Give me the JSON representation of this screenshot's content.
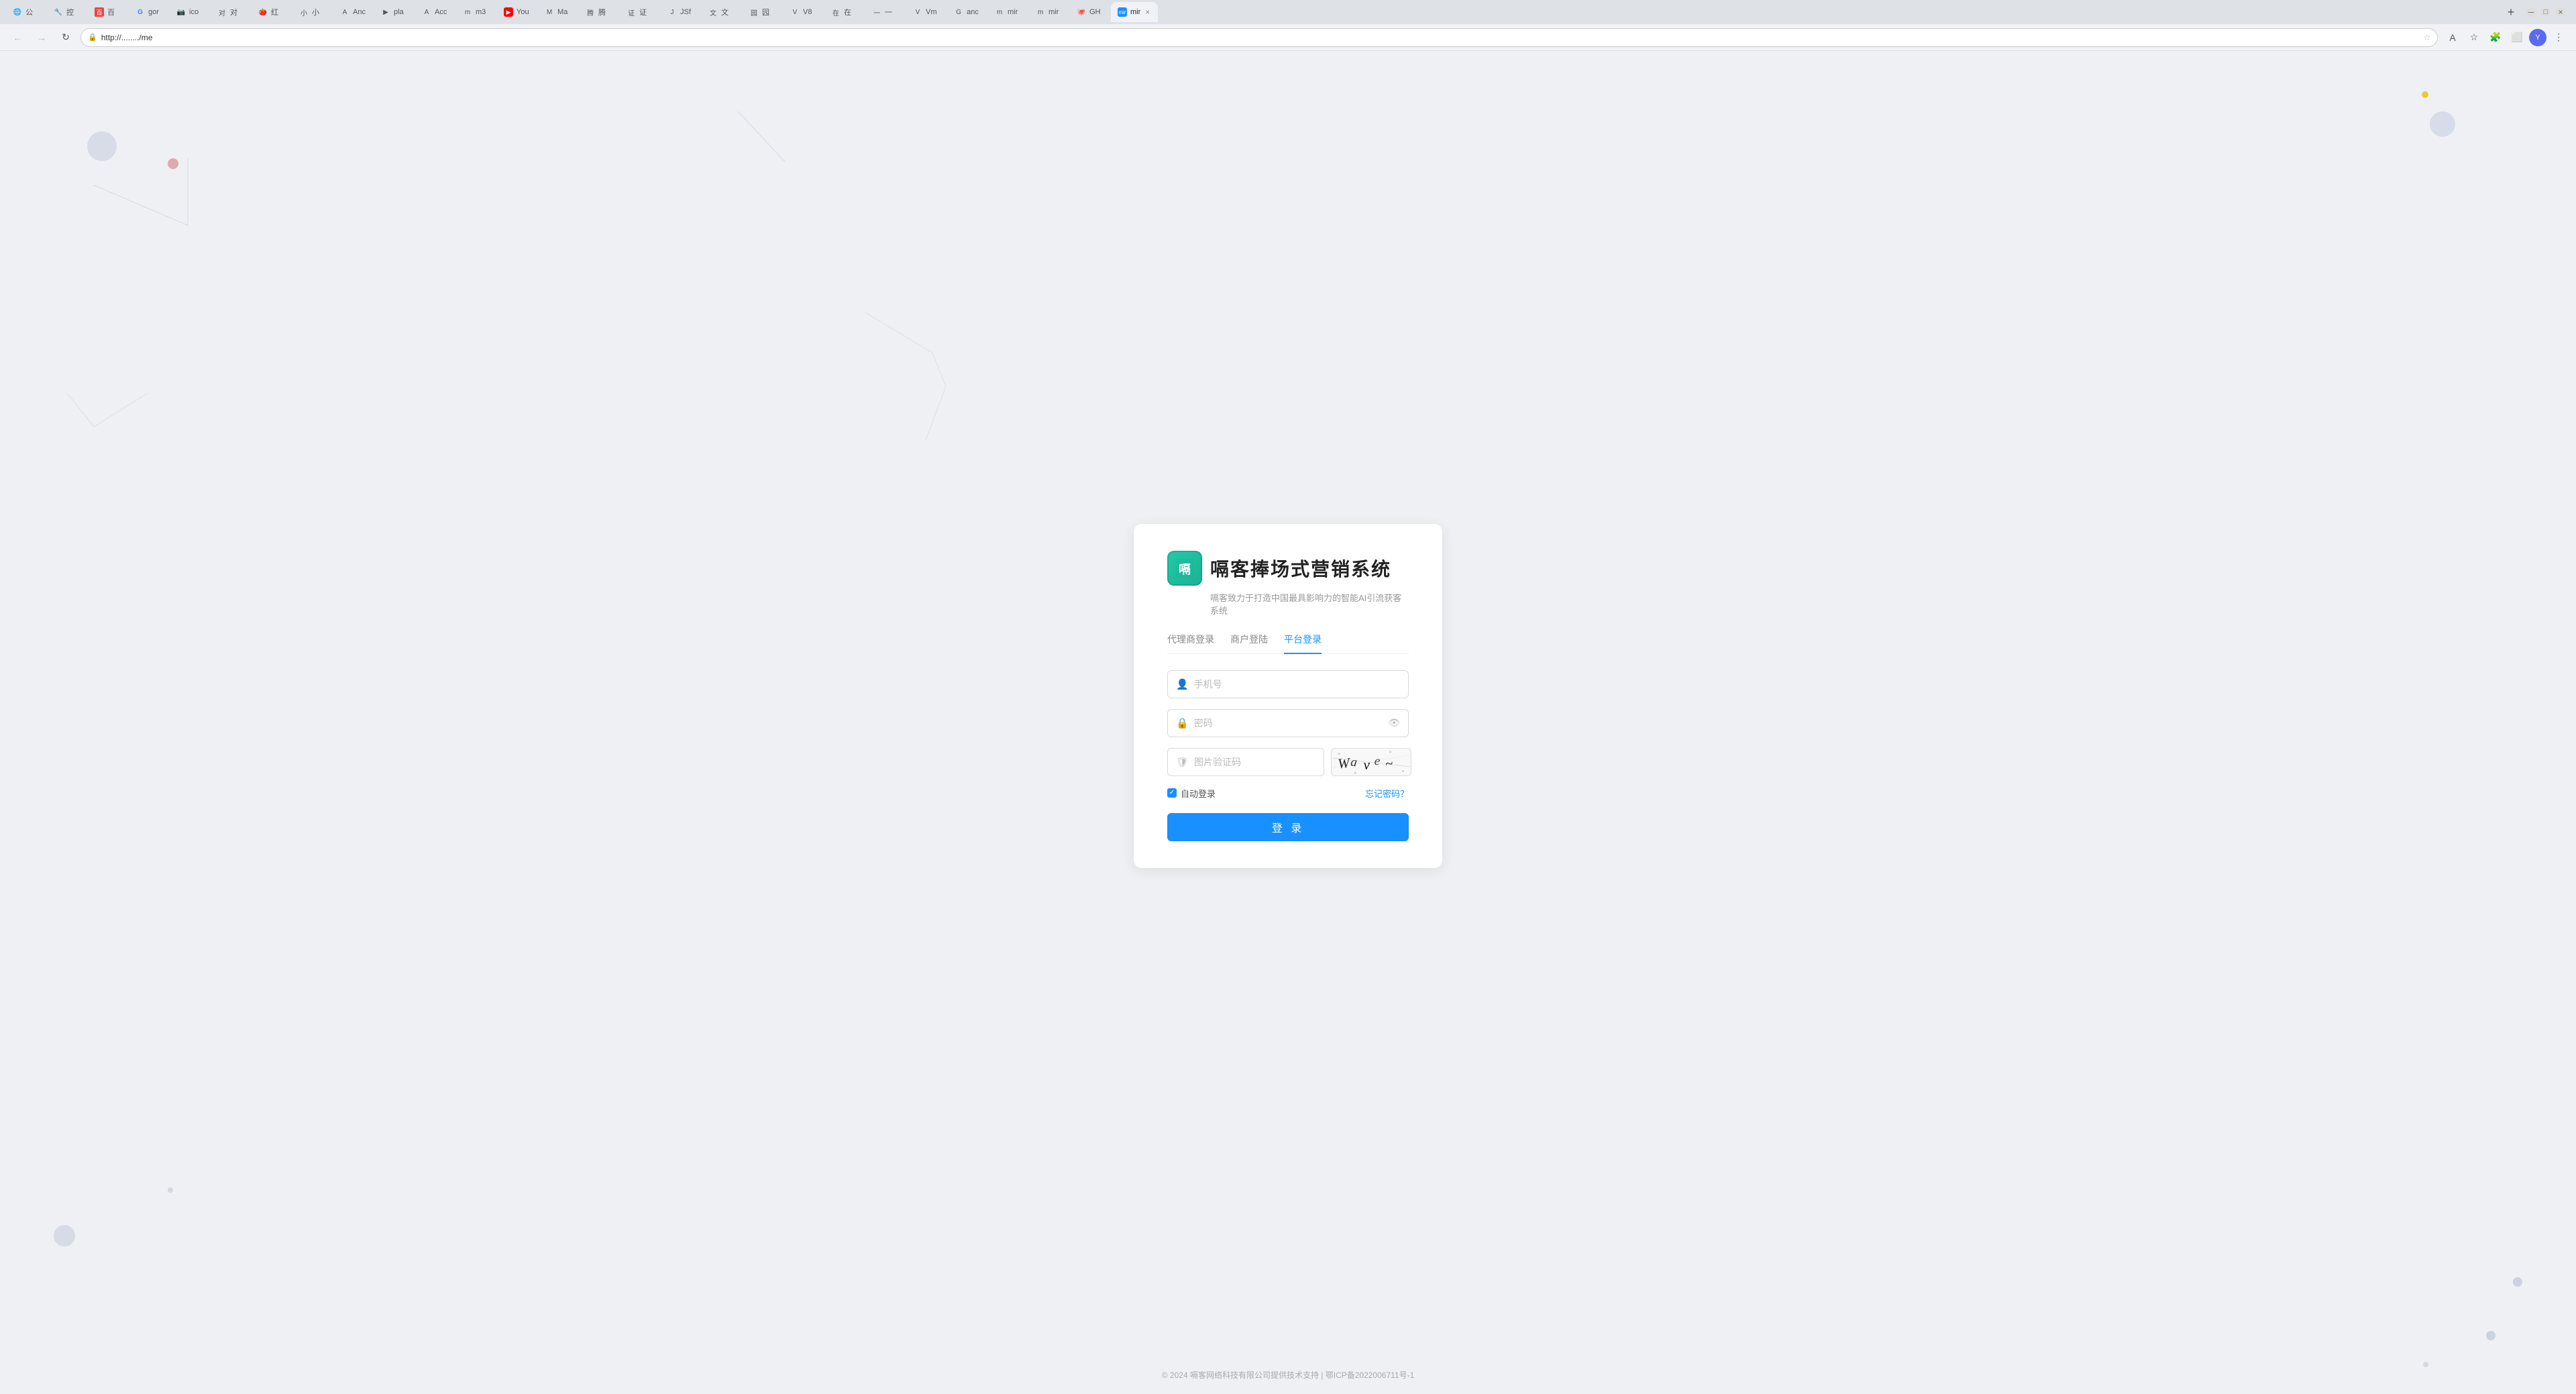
{
  "browser": {
    "url": "http://......../me",
    "tabs": [
      {
        "label": "公",
        "favicon": "公",
        "active": false
      },
      {
        "label": "控",
        "favicon": "控",
        "active": false
      },
      {
        "label": "百",
        "favicon": "百",
        "active": false
      },
      {
        "label": "gor",
        "favicon": "g",
        "active": false
      },
      {
        "label": "ico",
        "favicon": "i",
        "active": false
      },
      {
        "label": "对",
        "favicon": "对",
        "active": false
      },
      {
        "label": "红",
        "favicon": "红",
        "active": false
      },
      {
        "label": "小",
        "favicon": "小",
        "active": false
      },
      {
        "label": "Anc",
        "favicon": "A",
        "active": false
      },
      {
        "label": "pla",
        "favicon": "▶",
        "active": false
      },
      {
        "label": "Acc",
        "favicon": "A",
        "active": false
      },
      {
        "label": "m3",
        "favicon": "m",
        "active": false
      },
      {
        "label": "You",
        "favicon": "▶",
        "active": false
      },
      {
        "label": "Ma",
        "favicon": "M",
        "active": false
      },
      {
        "label": "腾",
        "favicon": "腾",
        "active": false
      },
      {
        "label": "证",
        "favicon": "证",
        "active": false
      },
      {
        "label": "JSf",
        "favicon": "J",
        "active": false
      },
      {
        "label": "文",
        "favicon": "文",
        "active": false
      },
      {
        "label": "园",
        "favicon": "园",
        "active": false
      },
      {
        "label": "V8",
        "favicon": "V",
        "active": false
      },
      {
        "label": "在",
        "favicon": "在",
        "active": false
      },
      {
        "label": "一",
        "favicon": "一",
        "active": false
      },
      {
        "label": "Vm",
        "favicon": "V",
        "active": false
      },
      {
        "label": "anc",
        "favicon": "a",
        "active": false
      },
      {
        "label": "mir",
        "favicon": "m",
        "active": false
      },
      {
        "label": "mir",
        "favicon": "m",
        "active": false
      },
      {
        "label": "GH",
        "favicon": "G",
        "active": false
      },
      {
        "label": "mir",
        "favicon": "m",
        "active": true
      }
    ],
    "profile_initial": "Y"
  },
  "page": {
    "brand": {
      "logo_text": "嗝",
      "title": "嗝客捧场式营销系统",
      "subtitle": "嗝客致力于打造中国最具影响力的智能AI引流获客系统"
    },
    "tabs": [
      {
        "label": "代理商登录",
        "active": false
      },
      {
        "label": "商户登陆",
        "active": false
      },
      {
        "label": "平台登录",
        "active": true
      }
    ],
    "form": {
      "phone_placeholder": "手机号",
      "password_placeholder": "密码",
      "captcha_placeholder": "图片验证码",
      "auto_login_label": "自动登录",
      "forgot_label": "忘记密码？",
      "login_btn": "登 录"
    },
    "footer": "© 2024 嗝客网络科技有限公司提供技术支持  |  鄂ICP备2022006711号-1"
  }
}
